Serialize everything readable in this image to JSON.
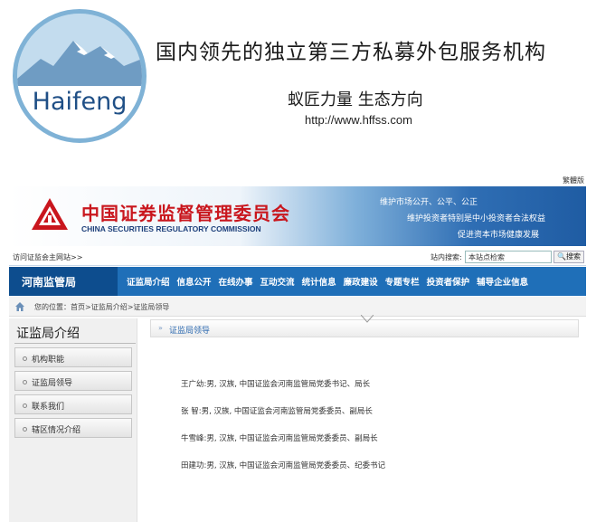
{
  "promo": {
    "logo_text": "Haifeng",
    "title": "国内领先的独立第三方私募外包服务机构",
    "slogan": "蚁匠力量  生态方向",
    "url": "http://www.hffss.com"
  },
  "site": {
    "top_link": "繁體版",
    "cn_name": "中国证券监督管理委员会",
    "en_name": "CHINA SECURITIES REGULATORY COMMISSION",
    "taglines": [
      "维护市场公开、公平、公正",
      "维护投资者特别是中小投资者合法权益",
      "促进资本市场健康发展"
    ],
    "visit_link": "访问证监会主网站>>",
    "search_label": "站内搜索:",
    "search_placeholder": "本站点检索",
    "search_button": "搜索",
    "bureau": "河南监管局",
    "nav": [
      "证监局介绍",
      "信息公开",
      "在线办事",
      "互动交流",
      "统计信息",
      "廉政建设",
      "专题专栏",
      "投资者保护",
      "辅导企业信息"
    ],
    "breadcrumb": "您的位置：首页>证监局介绍>证监局领导"
  },
  "sidebar": {
    "title": "证监局介绍",
    "items": [
      "机构职能",
      "证监局领导",
      "联系我们",
      "辖区情况介绍"
    ]
  },
  "panel": {
    "title": "证监局领导"
  },
  "leaders": [
    "王广幼:男, 汉族, 中国证监会河南监管局党委书记、局长",
    "张    智:男, 汉族, 中国证监会河南监管局党委委员、副局长",
    "牛雪峰:男, 汉族, 中国证监会河南监管局党委委员、副局长",
    "田建功:男, 汉族, 中国证监会河南监管局党委委员、纪委书记"
  ],
  "colors": {
    "nav_blue": "#1f6fb8",
    "bureau_blue": "#0d4d8e",
    "title_red": "#c9161d",
    "link_blue": "#2f6bb0"
  },
  "icons": [
    "mountain-logo-icon",
    "csrc-emblem-icon",
    "search-icon",
    "home-icon",
    "arrow-icon"
  ]
}
